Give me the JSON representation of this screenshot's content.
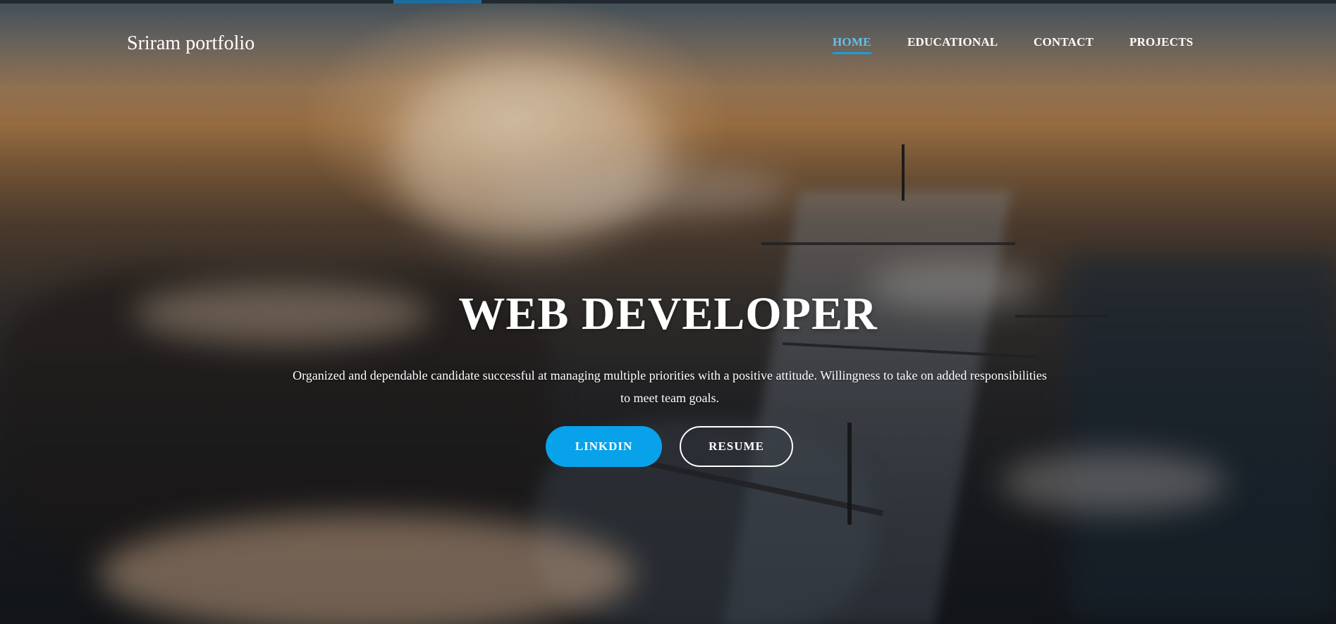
{
  "brand": {
    "title": "Sriram portfolio"
  },
  "nav": {
    "items": [
      {
        "label": "HOME",
        "active": true
      },
      {
        "label": "EDUCATIONAL",
        "active": false
      },
      {
        "label": "CONTACT",
        "active": false
      },
      {
        "label": "PROJECTS",
        "active": false
      }
    ]
  },
  "hero": {
    "headline": "WEB DEVELOPER",
    "tagline": "Organized and dependable candidate successful at managing multiple priorities with a positive attitude. Willingness to take on added responsibilities to meet team goals.",
    "buttons": {
      "linkedin_label": "LINKDIN",
      "resume_label": "RESUME"
    }
  },
  "colors": {
    "accent": "#08a2ea",
    "active_nav": "#62c1ee",
    "text": "#ffffff",
    "topbar": "#222931"
  }
}
